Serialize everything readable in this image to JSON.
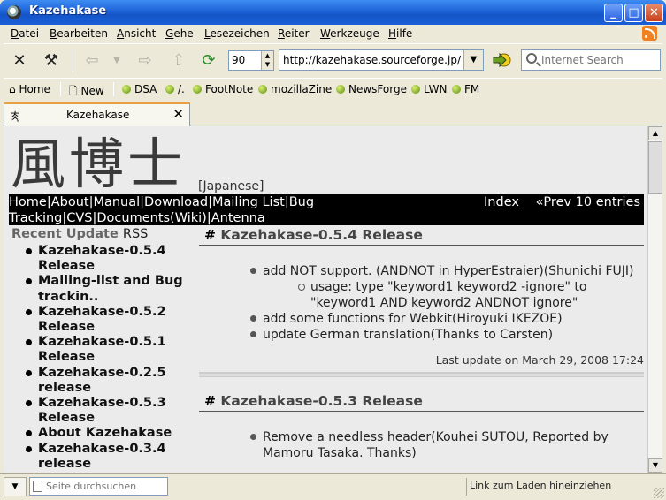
{
  "window": {
    "title": "Kazehakase"
  },
  "menu": [
    "Datei",
    "Bearbeiten",
    "Ansicht",
    "Gehe",
    "Lesezeichen",
    "Reiter",
    "Werkzeuge",
    "Hilfe"
  ],
  "toolbar": {
    "zoom": "90",
    "url": "http://kazehakase.sourceforge.jp/",
    "search_placeholder": "Internet Search"
  },
  "bookmarks": {
    "home": "Home",
    "new": "New",
    "items": [
      "DSA",
      "/.",
      "FootNote",
      "mozillaZine",
      "NewsForge",
      "LWN",
      "FM"
    ]
  },
  "tab": {
    "label": "Kazehakase",
    "favicon": "肉"
  },
  "page": {
    "lang_link": "[Japanese]",
    "nav_left": "Home|About|Manual|Download|Mailing List|Bug Tracking|CVS|Documents(Wiki)|Antenna",
    "nav_index": "Index",
    "nav_prev": "«Prev 10 entries",
    "sidebar": {
      "heading": "Recent Update",
      "heading_rss": "RSS",
      "items": [
        "Kazehakase-0.5.4 Release",
        "Mailing-list and Bug trackin..",
        "Kazehakase-0.5.2 Release",
        "Kazehakase-0.5.1 Release",
        "Kazehakase-0.2.5 release",
        "Kazehakase-0.5.3 Release",
        "About Kazehakase",
        "Kazehakase-0.3.4 release"
      ]
    },
    "entries": [
      {
        "title": "Kazehakase-0.5.4 Release",
        "items": [
          "add NOT support. (ANDNOT in HyperEstraier)(Shunichi FUJI)",
          "usage: type \"keyword1 keyword2 -ignore\" to \"keyword1 AND keyword2 ANDNOT ignore\"",
          "add some functions for Webkit(Hiroyuki IKEZOE)",
          "update German translation(Thanks to Carsten)"
        ],
        "last_update": "Last update on March 29, 2008 17:24"
      },
      {
        "title": "Kazehakase-0.5.3 Release",
        "items": [
          "Remove a needless header(Kouhei SUTOU, Reported by Mamoru Tasaka. Thanks)"
        ]
      }
    ]
  },
  "statusbar": {
    "find_placeholder": "Seite durchsuchen",
    "text": "Link zum Laden hineinziehen"
  }
}
